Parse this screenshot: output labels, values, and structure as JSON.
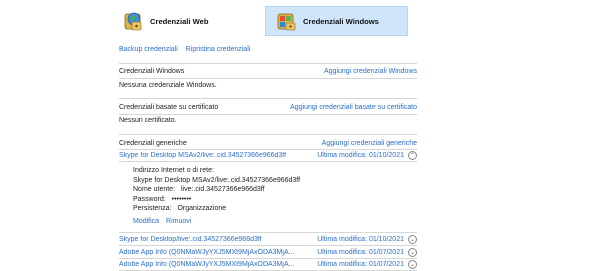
{
  "tabs": {
    "web": "Credenziali Web",
    "windows": "Credenziali Windows"
  },
  "actions": {
    "backup": "Backup credenziali",
    "restore": "Ripristina credenziali"
  },
  "windows_section": {
    "title": "Credenziali Windows",
    "add": "Aggiungi credenziali Windows",
    "empty": "Nessuna credenziale Windows."
  },
  "cert_section": {
    "title": "Credenziali basate su certificato",
    "add": "Aggiungi credenziali basate su certificato",
    "empty": "Nessun certificato."
  },
  "generic_section": {
    "title": "Credenziali generiche",
    "add": "Aggiungi credenziali generiche"
  },
  "expanded_item": {
    "name": "Skype for Desktop MSAv2/live:.cid.34527366e966d3ff",
    "date": "Ultima modifica: 01/10/2021",
    "address_label": "Indirizzo Internet o di rete:",
    "address_value": "Skype for Desktop MSAv2/live:.cid.34527366e966d3ff",
    "user_label": "Nome utente:",
    "user_value": "live:.cid.34527366e966d3ff",
    "password_label": "Password:",
    "password_value": "••••••••",
    "persistence_label": "Persistenza:",
    "persistence_value": "Organizzazione",
    "edit": "Modifica",
    "remove": "Rimuovi"
  },
  "items": [
    {
      "name": "Skype for Desktop/live:.cid.34527366e966d3ff",
      "date": "Ultima modifica: 01/10/2021"
    },
    {
      "name": "Adobe App Info (Q0NMaWJyYXJ5MXt9MjAxODA3MjA...",
      "date": "Ultima modifica: 01/07/2021"
    },
    {
      "name": "Adobe App Info (Q0NMaWJyYXJ5MXt9MjAxODA3MjA...",
      "date": "Ultima modifica: 01/07/2021"
    }
  ]
}
